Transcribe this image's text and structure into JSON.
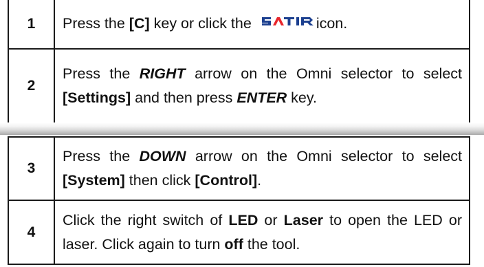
{
  "logo_text": "SATIR",
  "steps": [
    {
      "number": "1",
      "t1": "Press the ",
      "k1": "[C]",
      "t2": " key or click the",
      "t3": "icon."
    },
    {
      "number": "2",
      "t1": "Press the ",
      "k1": "RIGHT",
      "t2": " arrow on the Omni selector to select ",
      "k2": "[Settings]",
      "t3": " and then press ",
      "k3": "ENTER",
      "t4": " key."
    },
    {
      "number": "3",
      "t1": "Press the ",
      "k1": "DOWN",
      "t2": " arrow on the Omni selector to select ",
      "k2": "[System]",
      "t3": " then click ",
      "k3": "[Control]",
      "t4": "."
    },
    {
      "number": "4",
      "t1": "Click the right switch of ",
      "k1": "LED",
      "t2": " or ",
      "k2": "Laser",
      "t3": " to open the LED or laser. Click again to turn ",
      "k3": "off",
      "t4": " the tool."
    }
  ],
  "colors": {
    "border": "#1a1a1a",
    "logo_red": "#e8262b",
    "logo_blue": "#1b3f8f"
  }
}
